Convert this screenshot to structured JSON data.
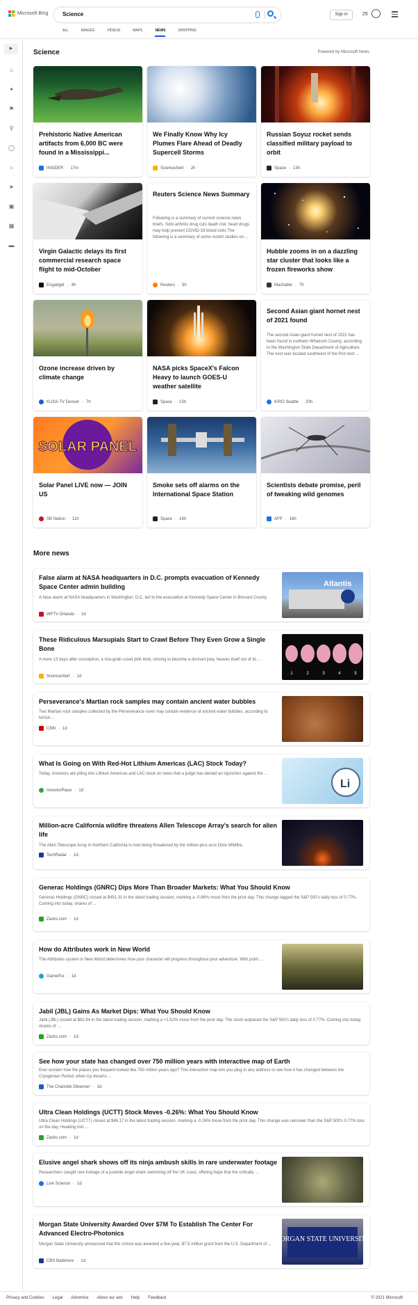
{
  "header": {
    "brand": "Microsoft Bing",
    "query": "Science",
    "signin": "Sign in",
    "points": "25",
    "tabs": [
      "ALL",
      "IMAGES",
      "VIDEOS",
      "MAPS",
      "NEWS",
      "SHOPPING"
    ]
  },
  "section": {
    "title": "Science",
    "powered": "Powered by Microsoft News"
  },
  "cards": [
    {
      "title": "Prehistoric Native American artifacts from 6,000 BC were found in a Mississippi...",
      "source": "INSIDER",
      "time": "17m"
    },
    {
      "title": "We Finally Know Why Icy Plumes Flare Ahead of Deadly Supercell Storms",
      "source": "ScienceAlert",
      "time": "2h"
    },
    {
      "title": "Russian Soyuz rocket sends classified military payload to orbit",
      "source": "Space",
      "time": "13h"
    },
    {
      "title": "Virgin Galactic delays its first commercial research space flight to mid-October",
      "source": "Engadget",
      "time": "4h"
    },
    {
      "title": "Reuters Science News Summary",
      "summary": "Following is a summary of current science news briefs. Sobi arthritis drug cuts death risk; heart drugs may help prevent COVID-19 blood clots The following is a summary of some recent studies on ...",
      "source": "Reuters",
      "time": "5h"
    },
    {
      "title": "Hubble zooms in on a dazzling star cluster that looks like a frozen fireworks show",
      "source": "Mashable",
      "time": "7h"
    },
    {
      "title": "Ozone increase driven by climate change",
      "source": "KUSA-TV Denver",
      "time": "7h"
    },
    {
      "title": "NASA picks SpaceX's Falcon Heavy to launch GOES-U weather satellite",
      "source": "Space",
      "time": "13h"
    },
    {
      "title": "Second Asian giant hornet nest of 2021 found",
      "summary": "The second Asian giant hornet nest of 2021 has been found in northern Whatcom County, according to the Washington State Department of Agriculture. The nest was located southwest of the first nest ...",
      "source": "KIRO Seattle",
      "time": "20h"
    },
    {
      "title": "Solar Panel LIVE now — JOIN US",
      "source": "SB Nation",
      "time": "11h",
      "image_text": "SOLAR PANEL"
    },
    {
      "title": "Smoke sets off alarms on the International Space Station",
      "source": "Space",
      "time": "14h"
    },
    {
      "title": "Scientists debate promise, peril of tweaking wild genomes",
      "source": "AFP",
      "time": "16h"
    }
  ],
  "more": {
    "title": "More news",
    "items": [
      {
        "title": "False alarm at NASA headquarters in D.C. prompts evacuation of Kennedy Space Center admin building",
        "snippet": "A false alarm at NASA headquarters in Washington, D.C. led to the evacuation at Kennedy Space Center in Brevard County.",
        "source": "WFTV Orlando",
        "time": "1d",
        "image_text": "Atlantis"
      },
      {
        "title": "These Ridiculous Marsupials Start to Crawl Before They Even Grow a Single Bone",
        "snippet": "A mere 13 days after conception, a rice-grain-sized pink blob, striving to become a dunnart joey, heaves itself out of its ...",
        "source": "ScienceAlert",
        "time": "1d",
        "image_labels": [
          "1",
          "2",
          "3",
          "4",
          "5"
        ]
      },
      {
        "title": "Perseverance's Martian rock samples may contain ancient water bubbles",
        "snippet": "Two Martian rock samples collected by the Perseverance rover may contain evidence of ancient water bubbles, according to NASA ...",
        "source": "CNN",
        "time": "1d"
      },
      {
        "title": "What Is Going on With Red-Hot Lithium Americas (LAC) Stock Today?",
        "snippet": "Today, investors are piling into Lithium Americas and LAC stock on news that a judge has denied an injunction against the ...",
        "source": "InvestorPlace",
        "time": "1d",
        "image_text": "Li"
      },
      {
        "title": "Million-acre California wildfire threatens Allen Telescope Array's search for alien life",
        "snippet": "The Allen Telescope Array in Northern California is now being threatened by the million-plus acre Dixie Wildfire.",
        "source": "TechRadar",
        "time": "1d"
      },
      {
        "title": "Generac Holdings (GNRC) Dips More Than Broader Markets: What You Should Know",
        "snippet": "Generac Holdings (GNRC) closed at $451.31 in the latest trading session, marking a -0.86% move from the prior day. This change lagged the S&P 500's daily loss of 0.77%. Coming into today, shares of ...",
        "source": "Zacks.com",
        "time": "1d"
      },
      {
        "title": "How do Attributes work in New World",
        "snippet": "The Attributes system in New World determines how your character will progress throughout your adventure. With point ...",
        "source": "GamePur",
        "time": "1d"
      },
      {
        "title": "Jabil (JBL) Gains As Market Dips: What You Should Know",
        "snippet": "Jabil (JBL) closed at $62.94 in the latest trading session, marking a +1.52% move from the prior day. The stock outpaced the S&P 500's daily loss of 0.77%. Coming into today, shares of ...",
        "source": "Zacks.com",
        "time": "1d"
      },
      {
        "title": "See how your state has changed over 750 million years with interactive map of Earth",
        "snippet": "Ever wonder how the places you frequent looked like 750 million years ago? This interactive map lets you plug in any address to see how it has changed between the Cryogenian Period, when icy deserts ...",
        "source": "The Charlotte Observer",
        "time": "1d"
      },
      {
        "title": "Ultra Clean Holdings (UCTT) Stock Moves -0.26%: What You Should Know",
        "snippet": "Ultra Clean Holdings (UCTT) closed at $46.17 in the latest trading session, marking a -0.26% move from the prior day. This change was narrower than the S&P 500's 0.77% loss on the day. Heading into ...",
        "source": "Zacks.com",
        "time": "1d"
      },
      {
        "title": "Elusive angel shark shows off its ninja ambush skills in rare underwater footage",
        "snippet": "Researchers caught rare footage of a juvenile angel shark swimming off the UK coast, offering hope that the critically ...",
        "source": "Live Science",
        "time": "1d"
      },
      {
        "title": "Morgan State University Awarded Over $7M To Establish The Center For Advanced Electro-Photonics",
        "snippet": "Morgan State University announced that the school was awarded a five-year, $7.5 million grant from the U.S. Department of ...",
        "source": "CBS Baltimore",
        "time": "1d",
        "image_text": "MORGAN STATE UNIVERSITY"
      }
    ]
  },
  "footer": {
    "links": [
      "Privacy and Cookies",
      "Legal",
      "Advertise",
      "About our ads",
      "Help",
      "Feedback"
    ],
    "copyright": "© 2021 Microsoft"
  },
  "colors": {
    "accent": "#174ae4",
    "logo": [
      "#f25022",
      "#7fba00",
      "#00a4ef",
      "#ffb900"
    ]
  }
}
